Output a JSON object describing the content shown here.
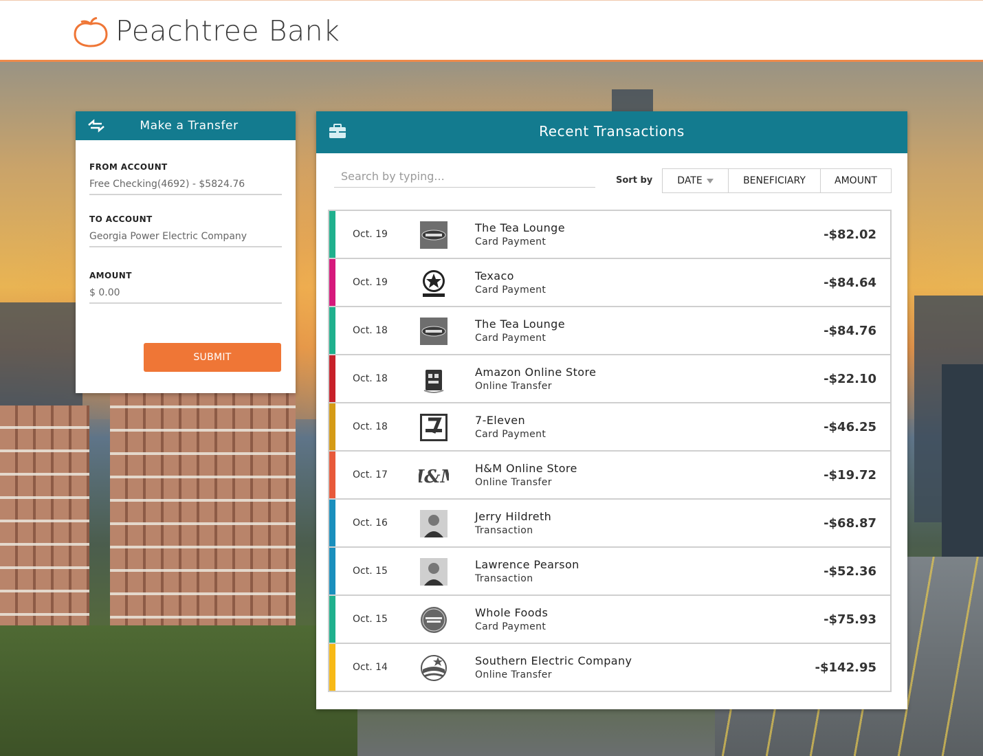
{
  "brand": {
    "name": "Peachtree Bank",
    "accent": "#ef7636",
    "header_line": "#ef8a4a"
  },
  "colors": {
    "panel_header": "#137b8f"
  },
  "transfer": {
    "title": "Make a Transfer",
    "icon": "transfer-arrows-icon",
    "from_label": "FROM ACCOUNT",
    "from_value": "Free Checking(4692) - $5824.76",
    "to_label": "TO ACCOUNT",
    "to_value": "Georgia Power Electric Company",
    "amount_label": "AMOUNT",
    "amount_value": "$ 0.00",
    "submit_label": "SUBMIT"
  },
  "transactions": {
    "title": "Recent Transactions",
    "icon": "briefcase-icon",
    "search_placeholder": "Search by typing...",
    "sort_label": "Sort by",
    "sort_options": [
      "DATE",
      "BENEFICIARY",
      "AMOUNT"
    ],
    "active_sort": "DATE",
    "rows": [
      {
        "date": "Oct. 19",
        "merchant": "The Tea Lounge",
        "type": "Card Payment",
        "amount": "-$82.02",
        "color": "#1fb08d",
        "logo": "tea-lounge-logo"
      },
      {
        "date": "Oct. 19",
        "merchant": "Texaco",
        "type": "Card Payment",
        "amount": "-$84.64",
        "color": "#d6197c",
        "logo": "texaco-logo"
      },
      {
        "date": "Oct. 18",
        "merchant": "The Tea Lounge",
        "type": "Card Payment",
        "amount": "-$84.76",
        "color": "#1fb08d",
        "logo": "tea-lounge-logo"
      },
      {
        "date": "Oct. 18",
        "merchant": "Amazon Online Store",
        "type": "Online Transfer",
        "amount": "-$22.10",
        "color": "#c7212a",
        "logo": "amazon-logo"
      },
      {
        "date": "Oct. 18",
        "merchant": "7-Eleven",
        "type": "Card Payment",
        "amount": "-$46.25",
        "color": "#d59b16",
        "logo": "seven-eleven-logo"
      },
      {
        "date": "Oct. 17",
        "merchant": "H&M Online Store",
        "type": "Online Transfer",
        "amount": "-$19.72",
        "color": "#e8593a",
        "logo": "hm-logo"
      },
      {
        "date": "Oct. 16",
        "merchant": "Jerry Hildreth",
        "type": "Transaction",
        "amount": "-$68.87",
        "color": "#1a8fbd",
        "logo": "person-photo"
      },
      {
        "date": "Oct. 15",
        "merchant": "Lawrence Pearson",
        "type": "Transaction",
        "amount": "-$52.36",
        "color": "#1a8fbd",
        "logo": "person-photo"
      },
      {
        "date": "Oct. 15",
        "merchant": "Whole Foods",
        "type": "Card Payment",
        "amount": "-$75.93",
        "color": "#1fb08d",
        "logo": "whole-foods-logo"
      },
      {
        "date": "Oct. 14",
        "merchant": "Southern Electric Company",
        "type": "Online Transfer",
        "amount": "-$142.95",
        "color": "#f7b916",
        "logo": "southern-electric-logo"
      }
    ]
  }
}
